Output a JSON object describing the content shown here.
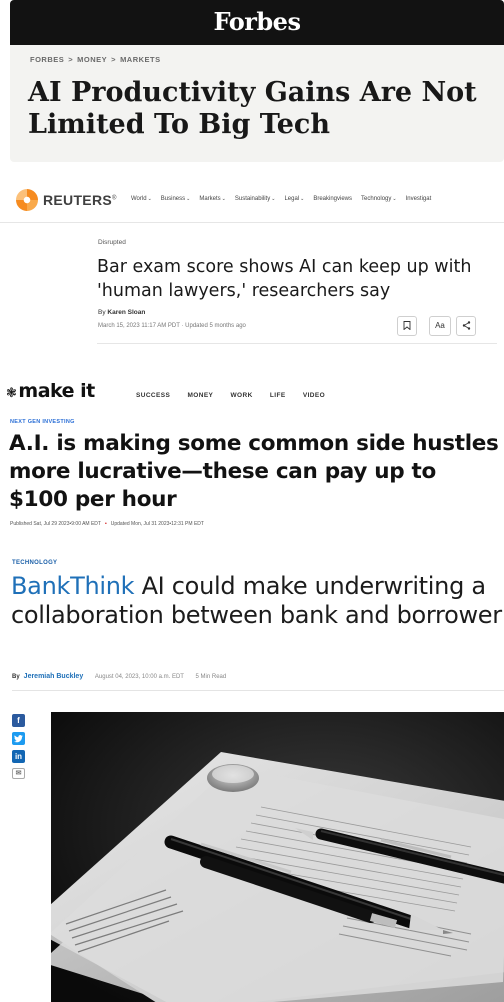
{
  "forbes": {
    "logo": "Forbes",
    "breadcrumbs": [
      "FORBES",
      "MONEY",
      "MARKETS"
    ],
    "crumb_sep": ">",
    "headline": "AI Productivity Gains Are Not Limited To Big Tech"
  },
  "reuters": {
    "logo": "REUTERS",
    "registered": "®",
    "nav": [
      "World",
      "Business",
      "Markets",
      "Sustainability",
      "Legal",
      "Breakingviews",
      "Technology",
      "Investigat"
    ],
    "nav_has_dropdown": [
      true,
      true,
      true,
      true,
      true,
      false,
      true,
      false
    ],
    "chevron": "⌄",
    "kicker": "Disrupted",
    "headline": "Bar exam score shows AI can keep up with 'human lawyers,' researchers say",
    "byline_prefix": "By",
    "author": "Karen Sloan",
    "date": "March 15, 2023 11:17 AM PDT · Updated 5 months ago",
    "tool_text_size": "Aa"
  },
  "makeit": {
    "logo": "make it",
    "nav": [
      "SUCCESS",
      "MONEY",
      "WORK",
      "LIFE",
      "VIDEO"
    ],
    "kicker": "NEXT GEN INVESTING",
    "headline": "A.I. is making some common side hustles more lucrative—these can pay up to $100 per hour",
    "published": "Published Sat, Jul 29 2023•9:00 AM EDT",
    "meta_dot": "•",
    "updated": "Updated Mon, Jul 31 2023•12:31 PM EDT"
  },
  "banker": {
    "kicker": "TECHNOLOGY",
    "brand": "BankThink",
    "headline": " AI could make underwriting a collaboration between bank and borrower",
    "by": "By",
    "author": "Jeremiah Buckley",
    "date": "August 04, 2023, 10:00 a.m. EDT",
    "read_time": "5 Min Read",
    "share": [
      "f",
      "t",
      "in",
      "✉"
    ]
  },
  "colors": {
    "forbes_bar": "#121212",
    "reuters_orange": "#f68b1f",
    "makeit_blue": "#2b6fd6",
    "banker_blue": "#1f70b8"
  }
}
